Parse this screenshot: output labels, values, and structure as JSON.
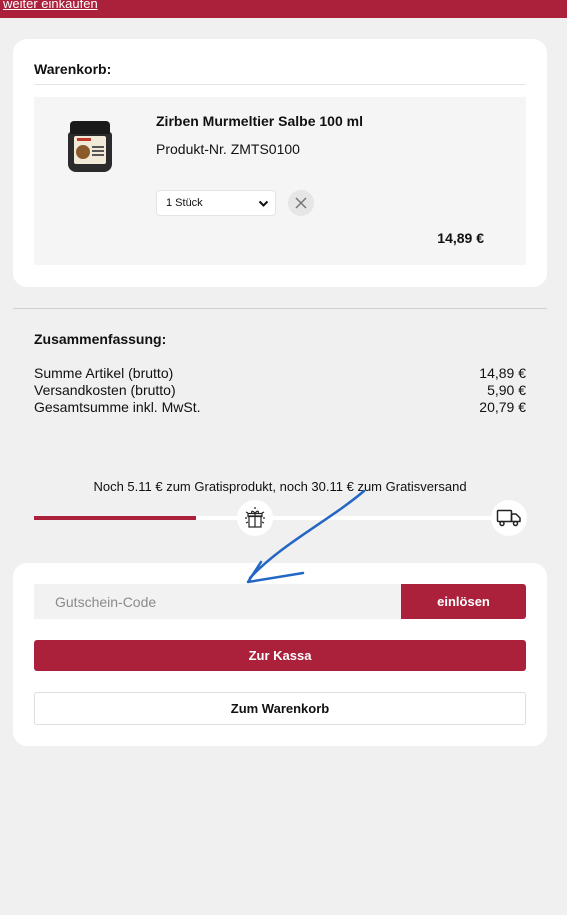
{
  "topbar": {
    "link_label": "weiter einkaufen"
  },
  "cart": {
    "title": "Warenkorb:",
    "item": {
      "name": "Zirben Murmeltier Salbe 100 ml",
      "product_nr": "Produkt-Nr. ZMTS0100",
      "quantity": "1 Stück",
      "price": "14,89 €"
    }
  },
  "summary": {
    "title": "Zusammenfassung:",
    "rows": [
      {
        "label": "Summe Artikel (brutto)",
        "value": "14,89 €"
      },
      {
        "label": "Versandkosten (brutto)",
        "value": "5,90 €"
      },
      {
        "label": "Gesamtsumme inkl. MwSt.",
        "value": "20,79 €"
      }
    ]
  },
  "progress": {
    "text": "Noch 5.11 € zum Gratisprodukt, noch 30.11 € zum Gratisversand",
    "fill_fraction": 0.34
  },
  "checkout": {
    "voucher_placeholder": "Gutschein-Code",
    "redeem_label": "einlösen",
    "kassa_label": "Zur Kassa",
    "warenkorb_label": "Zum Warenkorb"
  },
  "colors": {
    "brand": "#ab213b",
    "annotation_arrow": "#2366c6"
  },
  "icons": [
    "close-icon",
    "chevron-down-icon",
    "gift-icon",
    "truck-icon",
    "annotation-arrow"
  ]
}
